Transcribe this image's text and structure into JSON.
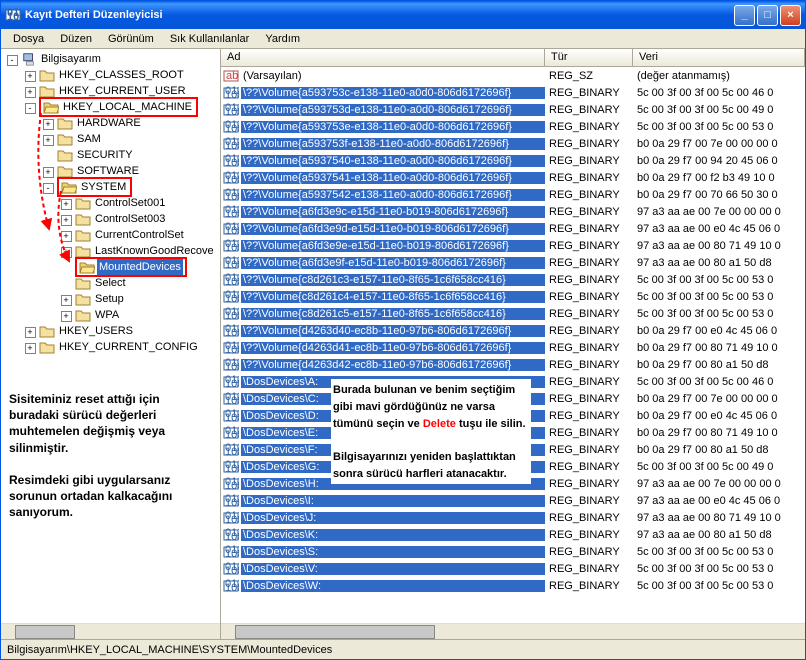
{
  "window": {
    "title": "Kayıt Defteri Düzenleyicisi"
  },
  "menu": {
    "file": "Dosya",
    "edit": "Düzen",
    "view": "Görünüm",
    "fav": "Sık Kullanılanlar",
    "help": "Yardım"
  },
  "tree": [
    {
      "label": "Bilgisayarım",
      "depth": 0,
      "exp": "-",
      "icon": "pc",
      "box": false
    },
    {
      "label": "HKEY_CLASSES_ROOT",
      "depth": 1,
      "exp": "+",
      "icon": "closed"
    },
    {
      "label": "HKEY_CURRENT_USER",
      "depth": 1,
      "exp": "+",
      "icon": "closed"
    },
    {
      "label": "HKEY_LOCAL_MACHINE",
      "depth": 1,
      "exp": "-",
      "icon": "open",
      "box": true
    },
    {
      "label": "HARDWARE",
      "depth": 2,
      "exp": "+",
      "icon": "closed"
    },
    {
      "label": "SAM",
      "depth": 2,
      "exp": "+",
      "icon": "closed"
    },
    {
      "label": "SECURITY",
      "depth": 2,
      "exp": "",
      "icon": "closed"
    },
    {
      "label": "SOFTWARE",
      "depth": 2,
      "exp": "+",
      "icon": "closed"
    },
    {
      "label": "SYSTEM",
      "depth": 2,
      "exp": "-",
      "icon": "open",
      "box": true
    },
    {
      "label": "ControlSet001",
      "depth": 3,
      "exp": "+",
      "icon": "closed"
    },
    {
      "label": "ControlSet003",
      "depth": 3,
      "exp": "+",
      "icon": "closed"
    },
    {
      "label": "CurrentControlSet",
      "depth": 3,
      "exp": "+",
      "icon": "closed"
    },
    {
      "label": "LastKnownGoodRecove",
      "depth": 3,
      "exp": "+",
      "icon": "closed"
    },
    {
      "label": "MountedDevices",
      "depth": 3,
      "exp": "",
      "icon": "open",
      "box": true,
      "sel": true
    },
    {
      "label": "Select",
      "depth": 3,
      "exp": "",
      "icon": "closed"
    },
    {
      "label": "Setup",
      "depth": 3,
      "exp": "+",
      "icon": "closed"
    },
    {
      "label": "WPA",
      "depth": 3,
      "exp": "+",
      "icon": "closed"
    },
    {
      "label": "HKEY_USERS",
      "depth": 1,
      "exp": "+",
      "icon": "closed"
    },
    {
      "label": "HKEY_CURRENT_CONFIG",
      "depth": 1,
      "exp": "+",
      "icon": "closed"
    }
  ],
  "cols": {
    "name": "Ad",
    "type": "Tür",
    "data": "Veri"
  },
  "default_row": {
    "name": "(Varsayılan)",
    "type": "REG_SZ",
    "data": "(değer atanmamış)"
  },
  "rows": [
    {
      "name": "\\??\\Volume{a593753c-e138-11e0-a0d0-806d6172696f}",
      "data": "5c 00 3f 00 3f 00 5c 00 46 0"
    },
    {
      "name": "\\??\\Volume{a593753d-e138-11e0-a0d0-806d6172696f}",
      "data": "5c 00 3f 00 3f 00 5c 00 49 0"
    },
    {
      "name": "\\??\\Volume{a593753e-e138-11e0-a0d0-806d6172696f}",
      "data": "5c 00 3f 00 3f 00 5c 00 53 0"
    },
    {
      "name": "\\??\\Volume{a593753f-e138-11e0-a0d0-806d6172696f}",
      "data": "b0 0a 29 f7 00 7e 00 00 00 0"
    },
    {
      "name": "\\??\\Volume{a5937540-e138-11e0-a0d0-806d6172696f}",
      "data": "b0 0a 29 f7 00 94 20 45 06 0"
    },
    {
      "name": "\\??\\Volume{a5937541-e138-11e0-a0d0-806d6172696f}",
      "data": "b0 0a 29 f7 00 f2 b3 49 10 0"
    },
    {
      "name": "\\??\\Volume{a5937542-e138-11e0-a0d0-806d6172696f}",
      "data": "b0 0a 29 f7 00 70 66 50 30 0"
    },
    {
      "name": "\\??\\Volume{a6fd3e9c-e15d-11e0-b019-806d6172696f}",
      "data": "97 a3 aa ae 00 7e 00 00 00 0"
    },
    {
      "name": "\\??\\Volume{a6fd3e9d-e15d-11e0-b019-806d6172696f}",
      "data": "97 a3 aa ae 00 e0 4c 45 06 0"
    },
    {
      "name": "\\??\\Volume{a6fd3e9e-e15d-11e0-b019-806d6172696f}",
      "data": "97 a3 aa ae 00 80 71 49 10 0"
    },
    {
      "name": "\\??\\Volume{a6fd3e9f-e15d-11e0-b019-806d6172696f}",
      "data": "97 a3 aa ae 00 80 a1 50 d8"
    },
    {
      "name": "\\??\\Volume{c8d261c3-e157-11e0-8f65-1c6f658cc416}",
      "data": "5c 00 3f 00 3f 00 5c 00 53 0"
    },
    {
      "name": "\\??\\Volume{c8d261c4-e157-11e0-8f65-1c6f658cc416}",
      "data": "5c 00 3f 00 3f 00 5c 00 53 0"
    },
    {
      "name": "\\??\\Volume{c8d261c5-e157-11e0-8f65-1c6f658cc416}",
      "data": "5c 00 3f 00 3f 00 5c 00 53 0"
    },
    {
      "name": "\\??\\Volume{d4263d40-ec8b-11e0-97b6-806d6172696f}",
      "data": "b0 0a 29 f7 00 e0 4c 45 06 0"
    },
    {
      "name": "\\??\\Volume{d4263d41-ec8b-11e0-97b6-806d6172696f}",
      "data": "b0 0a 29 f7 00 80 71 49 10 0"
    },
    {
      "name": "\\??\\Volume{d4263d42-ec8b-11e0-97b6-806d6172696f}",
      "data": "b0 0a 29 f7 00 80 a1 50 d8"
    },
    {
      "name": "\\DosDevices\\A:",
      "data": "5c 00 3f 00 3f 00 5c 00 46 0"
    },
    {
      "name": "\\DosDevices\\C:",
      "data": "b0 0a 29 f7 00 7e 00 00 00 0"
    },
    {
      "name": "\\DosDevices\\D:",
      "data": "b0 0a 29 f7 00 e0 4c 45 06 0"
    },
    {
      "name": "\\DosDevices\\E:",
      "data": "b0 0a 29 f7 00 80 71 49 10 0"
    },
    {
      "name": "\\DosDevices\\F:",
      "data": "b0 0a 29 f7 00 80 a1 50 d8"
    },
    {
      "name": "\\DosDevices\\G:",
      "data": "5c 00 3f 00 3f 00 5c 00 49 0"
    },
    {
      "name": "\\DosDevices\\H:",
      "data": "97 a3 aa ae 00 7e 00 00 00 0"
    },
    {
      "name": "\\DosDevices\\I:",
      "data": "97 a3 aa ae 00 e0 4c 45 06 0"
    },
    {
      "name": "\\DosDevices\\J:",
      "data": "97 a3 aa ae 00 80 71 49 10 0"
    },
    {
      "name": "\\DosDevices\\K:",
      "data": "97 a3 aa ae 00 80 a1 50 d8"
    },
    {
      "name": "\\DosDevices\\S:",
      "data": "5c 00 3f 00 3f 00 5c 00 53 0"
    },
    {
      "name": "\\DosDevices\\V:",
      "data": "5c 00 3f 00 3f 00 5c 00 53 0"
    },
    {
      "name": "\\DosDevices\\W:",
      "data": "5c 00 3f 00 3f 00 5c 00 53 0"
    }
  ],
  "row_type": "REG_BINARY",
  "status": "Bilgisayarım\\HKEY_LOCAL_MACHINE\\SYSTEM\\MountedDevices",
  "overlay_left": "Sisiteminiz reset attığı için buradaki sürücü değerleri muhtemelen değişmiş veya silinmiştir.\n\nResimdeki gibi uygularsanız sorunun ortadan kalkacağını sanıyorum.",
  "overlay_right_before": "Burada bulunan ve benim seçtiğim gibi mavi gördüğünüz ne varsa tümünü seçin ve ",
  "overlay_right_delete": "Delete",
  "overlay_right_after": " tuşu ile silin.\n\nBilgisayarınızı yeniden başlattıktan sonra sürücü harfleri atanacaktır."
}
